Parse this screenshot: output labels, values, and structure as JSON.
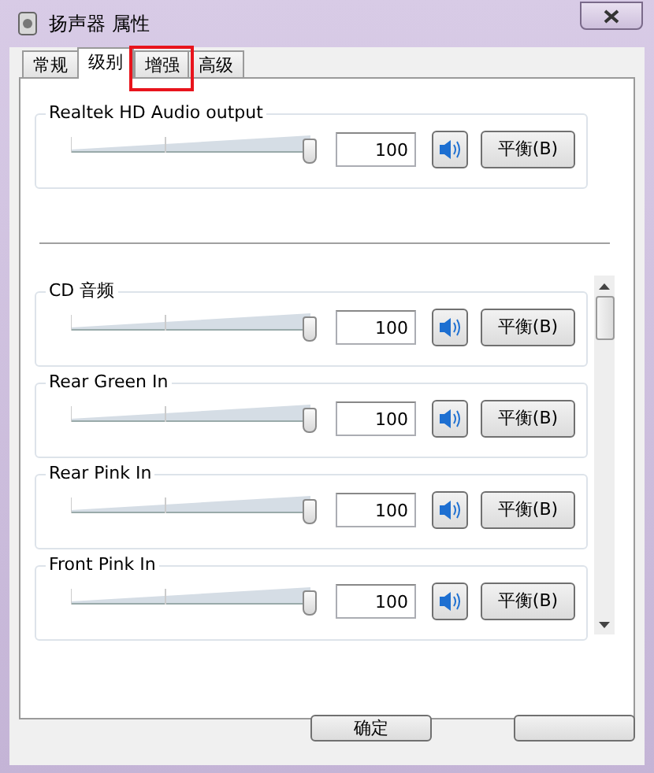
{
  "window": {
    "title": "扬声器 属性"
  },
  "tabs": [
    {
      "label": "常规",
      "selected": false,
      "highlighted": false
    },
    {
      "label": "级别",
      "selected": true,
      "highlighted": false
    },
    {
      "label": "增强",
      "selected": false,
      "highlighted": true
    },
    {
      "label": "高级",
      "selected": false,
      "highlighted": false
    }
  ],
  "output_device": {
    "name": "Realtek HD Audio output",
    "level": 1,
    "value": "100",
    "muted": false,
    "balance": "平衡(B)"
  },
  "devices": [
    {
      "name": "CD 音频",
      "level": 1,
      "value": "100",
      "muted": false,
      "balance": "平衡(B)"
    },
    {
      "name": "Rear Green In",
      "level": 1,
      "value": "100",
      "muted": false,
      "balance": "平衡(B)"
    },
    {
      "name": "Rear Pink In",
      "level": 1,
      "value": "100",
      "muted": false,
      "balance": "平衡(B)"
    },
    {
      "name": "Front Pink In",
      "level": 1,
      "value": "100",
      "muted": false,
      "balance": "平衡(B)"
    }
  ],
  "buttons": [
    {
      "kind": "labeled",
      "label": "确定"
    },
    {
      "kind": "covered"
    }
  ]
}
